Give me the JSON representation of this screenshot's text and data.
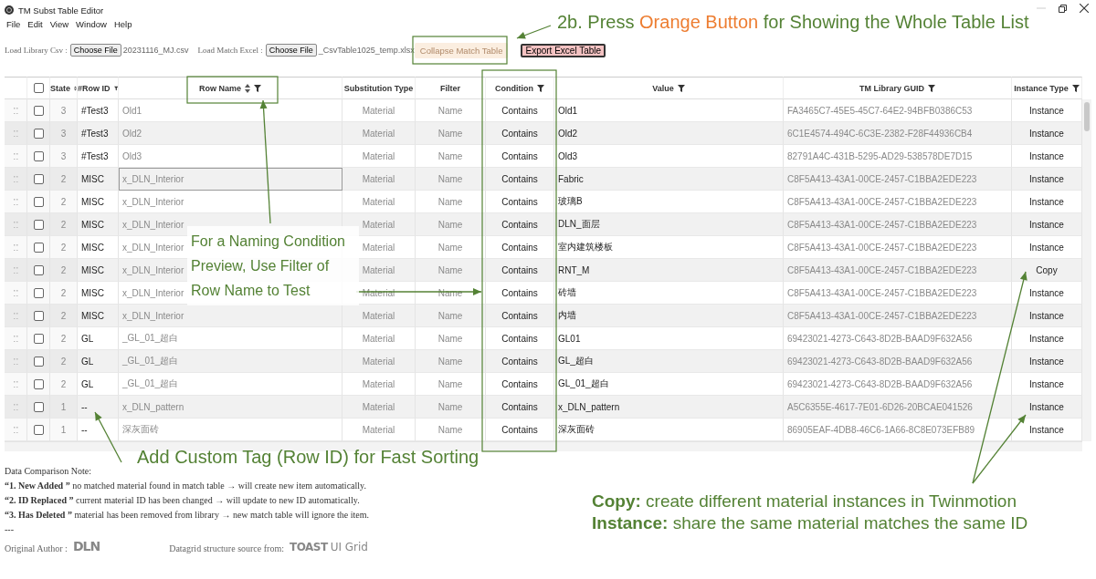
{
  "window": {
    "title": "TM Subst Table Editor"
  },
  "menu": [
    "File",
    "Edit",
    "View",
    "Window",
    "Help"
  ],
  "toolbar": {
    "library_label": "Load Library Csv :",
    "library_button": "Choose File",
    "library_file": "20231116_MJ.csv",
    "match_label": "Load Match Excel :",
    "match_button": "Choose File",
    "match_file": "_CsvTable1025_temp.xlsx",
    "collapse_button": "Collapse Match Table",
    "export_button": "Export Excel Table"
  },
  "grid": {
    "select_all": {
      "checked": false
    },
    "columns": [
      {
        "label": "State",
        "sortable": true,
        "filterable": false,
        "disabled": true
      },
      {
        "label": "#Row ID",
        "sortable": false,
        "filterable": true,
        "disabled": false
      },
      {
        "label": "Row Name",
        "sortable": true,
        "filterable": true,
        "disabled": true
      },
      {
        "label": "Substitution Type",
        "sortable": false,
        "filterable": false,
        "disabled": true
      },
      {
        "label": "Filter",
        "sortable": false,
        "filterable": false,
        "disabled": true
      },
      {
        "label": "Condition",
        "sortable": false,
        "filterable": true,
        "disabled": false
      },
      {
        "label": "Value",
        "sortable": false,
        "filterable": true,
        "disabled": false
      },
      {
        "label": "TM Library GUID",
        "sortable": false,
        "filterable": true,
        "disabled": true
      },
      {
        "label": "Instance Type",
        "sortable": false,
        "filterable": true,
        "disabled": false
      }
    ],
    "rows": [
      {
        "checked": false,
        "focused": false,
        "cells": [
          "3",
          "#Test3",
          "Old1",
          "Material",
          "Name",
          "Contains",
          "Old1",
          "FA3465C7-45E5-45C7-64E2-94BFB0386C53",
          "Instance"
        ]
      },
      {
        "checked": false,
        "focused": false,
        "cells": [
          "3",
          "#Test3",
          "Old2",
          "Material",
          "Name",
          "Contains",
          "Old2",
          "6C1E4574-494C-6C3E-2382-F28F44936CB4",
          "Instance"
        ]
      },
      {
        "checked": false,
        "focused": false,
        "cells": [
          "3",
          "#Test3",
          "Old3",
          "Material",
          "Name",
          "Contains",
          "Old3",
          "82791A4C-431B-5295-AD29-538578DE7D15",
          "Instance"
        ]
      },
      {
        "checked": false,
        "focused": true,
        "cells": [
          "2",
          "MISC",
          "x_DLN_Interior",
          "Material",
          "Name",
          "Contains",
          "Fabric",
          "C8F5A413-43A1-00CE-2457-C1BBA2EDE223",
          "Instance"
        ]
      },
      {
        "checked": false,
        "focused": false,
        "cells": [
          "2",
          "MISC",
          "x_DLN_Interior",
          "Material",
          "Name",
          "Contains",
          "玻璃B",
          "C8F5A413-43A1-00CE-2457-C1BBA2EDE223",
          "Instance"
        ]
      },
      {
        "checked": false,
        "focused": false,
        "cells": [
          "2",
          "MISC",
          "x_DLN_Interior",
          "Material",
          "Name",
          "Contains",
          "DLN_面层",
          "C8F5A413-43A1-00CE-2457-C1BBA2EDE223",
          "Instance"
        ]
      },
      {
        "checked": false,
        "focused": false,
        "cells": [
          "2",
          "MISC",
          "x_DLN_Interior",
          "Material",
          "Name",
          "Contains",
          "室内建筑楼板",
          "C8F5A413-43A1-00CE-2457-C1BBA2EDE223",
          "Instance"
        ]
      },
      {
        "checked": false,
        "focused": false,
        "cells": [
          "2",
          "MISC",
          "x_DLN_Interior",
          "Material",
          "Name",
          "Contains",
          "RNT_M",
          "C8F5A413-43A1-00CE-2457-C1BBA2EDE223",
          "Copy"
        ]
      },
      {
        "checked": false,
        "focused": false,
        "cells": [
          "2",
          "MISC",
          "x_DLN_Interior",
          "Material",
          "Name",
          "Contains",
          "砖墙",
          "C8F5A413-43A1-00CE-2457-C1BBA2EDE223",
          "Instance"
        ]
      },
      {
        "checked": false,
        "focused": false,
        "cells": [
          "2",
          "MISC",
          "x_DLN_Interior",
          "Material",
          "Name",
          "Contains",
          "内墙",
          "C8F5A413-43A1-00CE-2457-C1BBA2EDE223",
          "Instance"
        ]
      },
      {
        "checked": false,
        "focused": false,
        "cells": [
          "2",
          "GL",
          "_GL_01_超白",
          "Material",
          "Name",
          "Contains",
          "GL01",
          "69423021-4273-C643-8D2B-BAAD9F632A56",
          "Instance"
        ]
      },
      {
        "checked": false,
        "focused": false,
        "cells": [
          "2",
          "GL",
          "_GL_01_超白",
          "Material",
          "Name",
          "Contains",
          "GL_超白",
          "69423021-4273-C643-8D2B-BAAD9F632A56",
          "Instance"
        ]
      },
      {
        "checked": false,
        "focused": false,
        "cells": [
          "2",
          "GL",
          "_GL_01_超白",
          "Material",
          "Name",
          "Contains",
          "GL_01_超白",
          "69423021-4273-C643-8D2B-BAAD9F632A56",
          "Instance"
        ]
      },
      {
        "checked": false,
        "focused": false,
        "cells": [
          "1",
          "--",
          "x_DLN_pattern",
          "Material",
          "Name",
          "Contains",
          "x_DLN_pattern",
          "A5C6355E-4617-7E01-6D26-20BCAE041526",
          "Instance"
        ]
      },
      {
        "checked": false,
        "focused": false,
        "cells": [
          "1",
          "--",
          "深灰面砖",
          "Material",
          "Name",
          "Contains",
          "深灰面砖",
          "86905EAF-4DB8-46C6-1A66-8C8E073EFB89",
          "Instance"
        ]
      }
    ]
  },
  "notes": {
    "heading": "Data Comparison Note:",
    "items": [
      "**“1. New Added ”** no matched material found in match table → will create new item automatically.",
      "**“2. ID Replaced ”** current material ID has been changed → will update to new ID automatically.",
      "**“3. Has Deleted ”** material has been removed from library → new match table will ignore the item."
    ],
    "separator": "---",
    "author_label": "Original Author :",
    "author_logo": "DLN",
    "source_label": "Datagrid structure source from:",
    "source_logo_bold": "TOAST",
    "source_logo_rest": "UI Grid"
  },
  "annotations": {
    "top_note": [
      {
        "text": "2b. Press ",
        "color": "#548235"
      },
      {
        "text": "Orange Button",
        "color": "#ed7d31"
      },
      {
        "text": " for Showing the Whole Table List",
        "color": "#548235"
      }
    ],
    "callout": "For a Naming Condition Preview, Use Filter of Row Name to Test",
    "row_id_note": "Add Custom Tag (Row ID) for Fast Sorting",
    "instance_note": [
      "**Copy:** create different material instances in Twinmotion",
      "**Instance:** share the same material matches the same ID"
    ]
  }
}
